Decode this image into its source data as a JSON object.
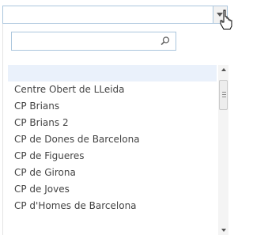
{
  "select": {
    "value": "",
    "arrow_icon": "chevron-down-icon"
  },
  "dropdown": {
    "search": {
      "value": "",
      "placeholder": "",
      "icon": "search-icon"
    },
    "items": [
      {
        "label": ""
      },
      {
        "label": "Centre Obert de LLeida"
      },
      {
        "label": "CP Brians"
      },
      {
        "label": "CP Brians 2"
      },
      {
        "label": "CP de Dones de Barcelona"
      },
      {
        "label": "CP de Figueres"
      },
      {
        "label": "CP de Girona"
      },
      {
        "label": "CP de Joves"
      },
      {
        "label": "CP d'Homes de Barcelona"
      }
    ],
    "highlighted_index": 0
  },
  "colors": {
    "border": "#abc6dd",
    "highlight": "#eaf1fb",
    "text": "#444444"
  }
}
